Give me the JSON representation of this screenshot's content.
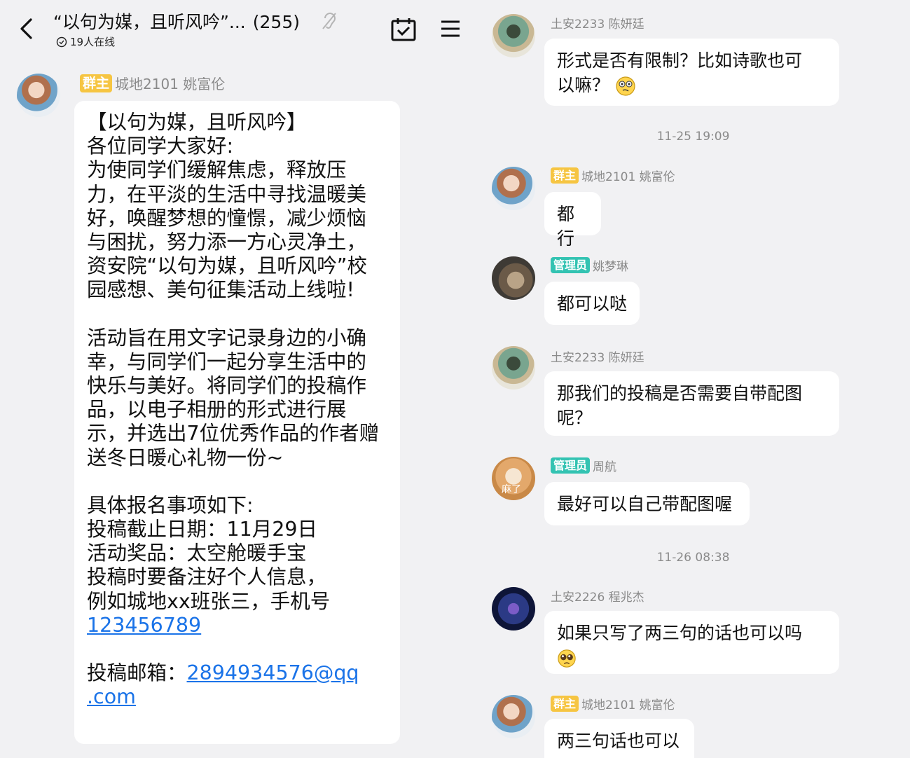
{
  "header": {
    "title": "“以句为媒，且听风吟”...",
    "count": "(255)",
    "online": "19人在线"
  },
  "left_chat": {
    "message": {
      "badge": "群主",
      "sender": "城地2101 姚富伦",
      "lines": [
        "【以句为媒，且听风吟】",
        "各位同学大家好:",
        "为使同学们缓解焦虑，释放压",
        "力，在平淡的生活中寻找温暖美",
        "好，唤醒梦想的憧憬，减少烦恼",
        "与困扰，努力添一方心灵净土，",
        "资安院“以句为媒，且听风吟”校",
        "园感想、美句征集活动上线啦!",
        "",
        "活动旨在用文字记录身边的小确",
        "幸，与同学们一起分享生活中的",
        "快乐与美好。将同学们的投稿作",
        "品，以电子相册的形式进行展",
        "示，并选出7位优秀作品的作者赠",
        "送冬日暖心礼物一份~",
        "",
        "具体报名事项如下:",
        "投稿截止日期：11月29日",
        "活动奖品：太空舱暖手宝",
        "投稿时要备注好个人信息，",
        "例如城地xx班张三，手机号"
      ],
      "phone": "123456789",
      "email_label": "投稿邮箱：",
      "email_part1": "2894934576@qq",
      "email_part2": ".com"
    }
  },
  "right_chat": {
    "m1": {
      "sender": "土安2233 陈妍廷",
      "line1": "形式是否有限制？比如诗歌也可",
      "line2": "以嘛？",
      "emoji": "thinking-face"
    },
    "ts1": "11-25 19:09",
    "m2": {
      "badge": "群主",
      "sender": "城地2101 姚富伦",
      "text": "都行"
    },
    "m3": {
      "badge": "管理员",
      "sender": "姚梦琳",
      "text": "都可以哒"
    },
    "m4": {
      "sender": "土安2233 陈妍廷",
      "line1": "那我们的投稿是否需要自带配图",
      "line2": "呢？"
    },
    "m5": {
      "badge": "管理员",
      "sender": "周航",
      "text": "最好可以自己带配图喔",
      "avatar_text": "麻了"
    },
    "ts2": "11-26 08:38",
    "m6": {
      "sender": "土安2226 程兆杰",
      "line1": "如果只写了两三句的话也可以吗",
      "emoji": "pleading-face"
    },
    "m7": {
      "badge": "群主",
      "sender": "城地2101 姚富伦",
      "text": "两三句话也可以"
    }
  },
  "colors": {
    "owner_badge": "#f6c542",
    "admin_badge": "#33c3b2",
    "link": "#1a73e8",
    "background": "#f1f1f3"
  }
}
